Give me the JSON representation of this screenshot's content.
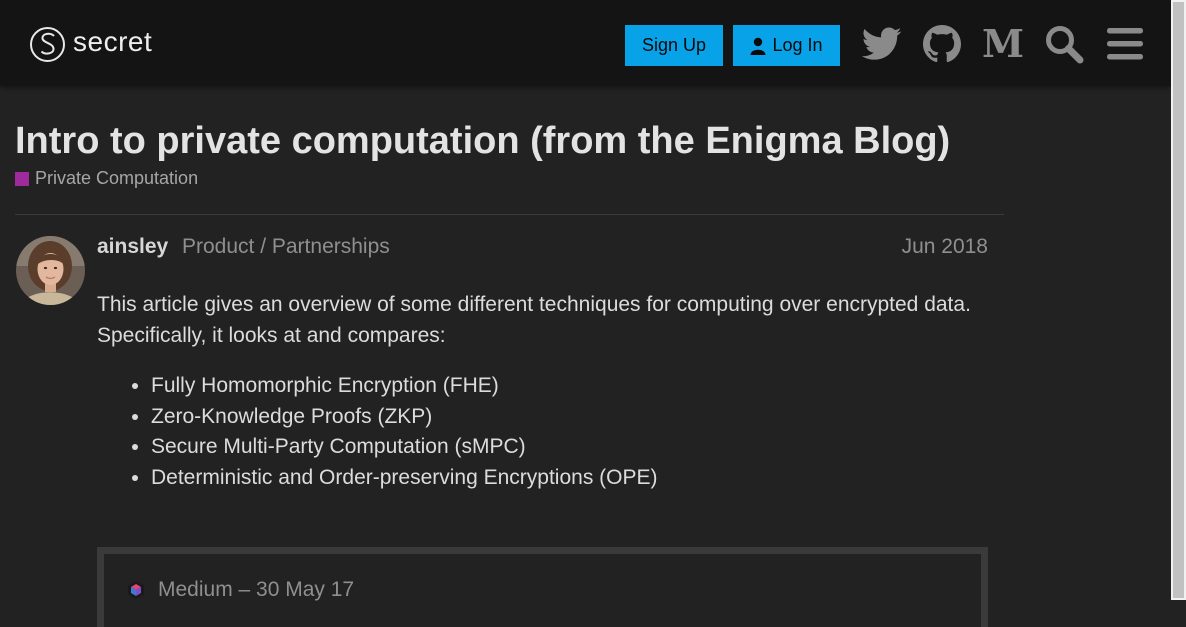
{
  "header": {
    "logo_text": "secret",
    "signup_label": "Sign Up",
    "login_label": "Log In",
    "icons": [
      "twitter-icon",
      "github-icon",
      "medium-icon",
      "search-icon",
      "hamburger-menu-icon"
    ],
    "medium_letter": "M"
  },
  "topic": {
    "title": "Intro to private computation (from the Enigma Blog)",
    "category": "Private Computation",
    "category_color": "#9e2a9b"
  },
  "post": {
    "username": "ainsley",
    "user_title": "Product / Partnerships",
    "date": "Jun 2018",
    "paragraph_1": "This article gives an overview of some different techniques for computing over encrypted data.",
    "paragraph_2": "Specifically, it looks at and compares:",
    "list": [
      "Fully Homomorphic Encryption (FHE)",
      "Zero-Knowledge Proofs (ZKP)",
      "Secure Multi-Party Computation (sMPC)",
      "Deterministic and Order-preserving Encryptions (OPE)"
    ],
    "onebox_source": "Medium – 30 May 17"
  },
  "colors": {
    "accent": "#08a2e9",
    "header_bg": "#141414",
    "page_bg": "#222222"
  }
}
